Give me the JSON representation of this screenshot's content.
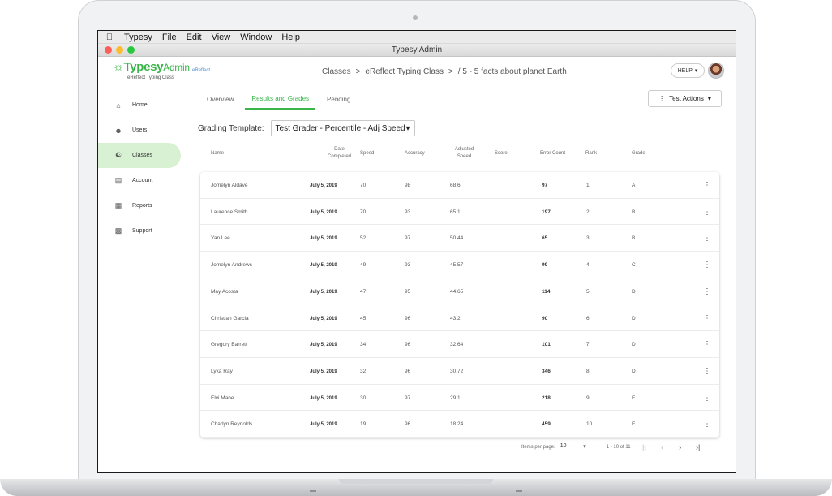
{
  "menubar": {
    "apple": "",
    "items": [
      "Typesy",
      "File",
      "Edit",
      "View",
      "Window",
      "Help"
    ]
  },
  "window": {
    "title": "Typesy Admin"
  },
  "header": {
    "logo": "Typesy",
    "logo_admin": "Admin",
    "logo_sub": "eReflect Typing Class",
    "partner": "eReflect",
    "breadcrumb": [
      "Classes",
      ">",
      "eReflect Typing Class",
      ">",
      "/ 5 - 5 facts about planet Earth"
    ],
    "help": "HELP"
  },
  "sidebar": {
    "items": [
      {
        "label": "Home",
        "icon": "home-icon"
      },
      {
        "label": "Users",
        "icon": "user-icon"
      },
      {
        "label": "Classes",
        "icon": "classes-icon",
        "active": true
      },
      {
        "label": "Account",
        "icon": "clipboard-icon"
      },
      {
        "label": "Reports",
        "icon": "report-icon"
      },
      {
        "label": "Support",
        "icon": "support-icon"
      }
    ]
  },
  "tabs": [
    "Overview",
    "Results and Grades",
    "Pending"
  ],
  "test_actions": "Test Actions",
  "grading": {
    "label": "Grading Template:",
    "value": "Test Grader - Percentile - Adj Speed"
  },
  "table": {
    "headers": {
      "name": "Name",
      "date1": "Date",
      "date2": "Completed",
      "speed": "Speed",
      "accuracy": "Accuracy",
      "adj1": "Adjusted",
      "adj2": "Speed",
      "score": "Score",
      "errors": "Error Count",
      "rank": "Rank",
      "grade": "Grade"
    },
    "rows": [
      {
        "name": "Jomelyn Aldave",
        "date": "July 5, 2019",
        "speed": "70",
        "accuracy": "98",
        "adj": "68.6",
        "errors": "97",
        "rank": "1",
        "grade": "A"
      },
      {
        "name": "Laurence Smith",
        "date": "July 5, 2019",
        "speed": "70",
        "accuracy": "93",
        "adj": "65.1",
        "errors": "197",
        "rank": "2",
        "grade": "B"
      },
      {
        "name": "Yan Lee",
        "date": "July 5, 2019",
        "speed": "52",
        "accuracy": "97",
        "adj": "50.44",
        "errors": "65",
        "rank": "3",
        "grade": "B"
      },
      {
        "name": "Jomelyn Andrews",
        "date": "July 5, 2019",
        "speed": "49",
        "accuracy": "93",
        "adj": "45.57",
        "errors": "99",
        "rank": "4",
        "grade": "C"
      },
      {
        "name": "May Acosta",
        "date": "July 5, 2019",
        "speed": "47",
        "accuracy": "95",
        "adj": "44.65",
        "errors": "114",
        "rank": "5",
        "grade": "D"
      },
      {
        "name": "Christian Garcia",
        "date": "July 5, 2019",
        "speed": "45",
        "accuracy": "96",
        "adj": "43.2",
        "errors": "90",
        "rank": "6",
        "grade": "D"
      },
      {
        "name": "Gregory Barrett",
        "date": "July 5, 2019",
        "speed": "34",
        "accuracy": "96",
        "adj": "32.64",
        "errors": "101",
        "rank": "7",
        "grade": "D"
      },
      {
        "name": "Lyka Ray",
        "date": "July 5, 2019",
        "speed": "32",
        "accuracy": "96",
        "adj": "30.72",
        "errors": "346",
        "rank": "8",
        "grade": "D"
      },
      {
        "name": "Elvi Mane",
        "date": "July 5, 2019",
        "speed": "30",
        "accuracy": "97",
        "adj": "29.1",
        "errors": "218",
        "rank": "9",
        "grade": "E"
      },
      {
        "name": "Charlyn Reynolds",
        "date": "July 5, 2019",
        "speed": "19",
        "accuracy": "96",
        "adj": "18.24",
        "errors": "459",
        "rank": "10",
        "grade": "E"
      }
    ]
  },
  "pagination": {
    "items_per_page_label": "Items per page:",
    "items_per_page": "10",
    "range": "1 - 10 of 11"
  }
}
